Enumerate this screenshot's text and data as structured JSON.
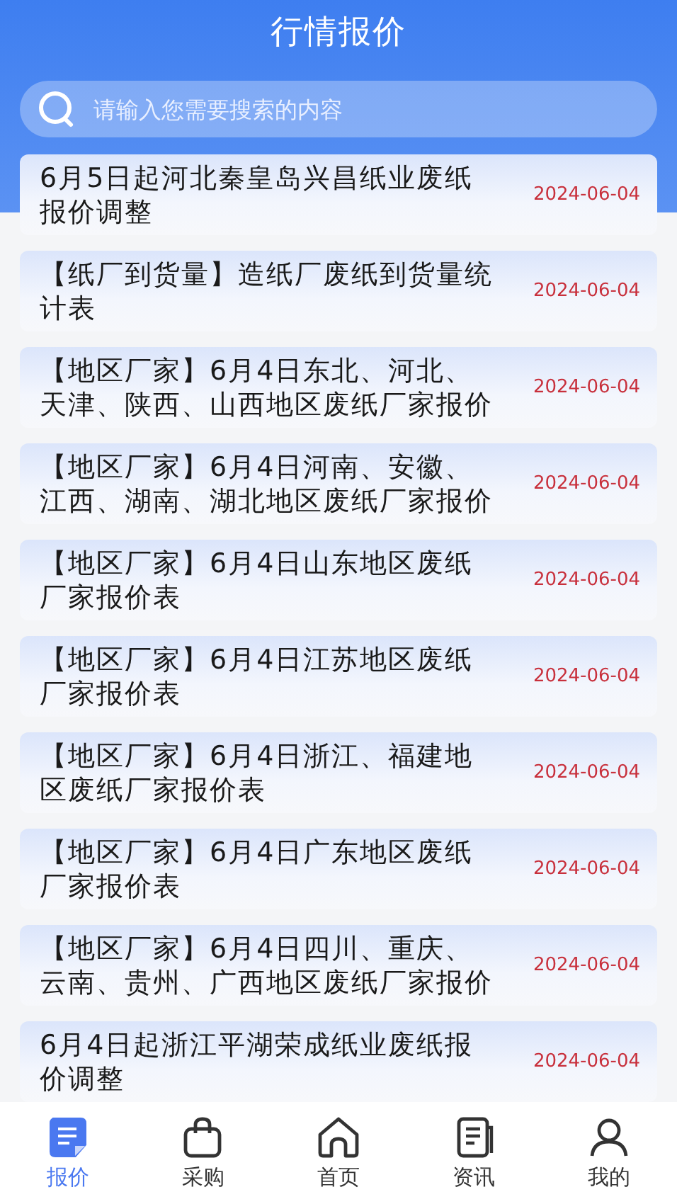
{
  "header": {
    "title": "行情报价"
  },
  "search": {
    "placeholder": "请输入您需要搜索的内容"
  },
  "items": [
    {
      "title": "6月5日起河北秦皇岛兴昌纸业废纸报价调整",
      "date": "2024-06-04"
    },
    {
      "title": "【纸厂到货量】造纸厂废纸到货量统计表",
      "date": "2024-06-04"
    },
    {
      "title": "【地区厂家】6月4日东北、河北、天津、陕西、山西地区废纸厂家报价",
      "date": "2024-06-04"
    },
    {
      "title": "【地区厂家】6月4日河南、安徽、江西、湖南、湖北地区废纸厂家报价",
      "date": "2024-06-04"
    },
    {
      "title": "【地区厂家】6月4日山东地区废纸厂家报价表",
      "date": "2024-06-04"
    },
    {
      "title": "【地区厂家】6月4日江苏地区废纸厂家报价表",
      "date": "2024-06-04"
    },
    {
      "title": "【地区厂家】6月4日浙江、福建地区废纸厂家报价表",
      "date": "2024-06-04"
    },
    {
      "title": "【地区厂家】6月4日广东地区废纸厂家报价表",
      "date": "2024-06-04"
    },
    {
      "title": "【地区厂家】6月4日四川、重庆、云南、贵州、广西地区废纸厂家报价",
      "date": "2024-06-04"
    },
    {
      "title": "6月4日起浙江平湖荣成纸业废纸报价调整",
      "date": "2024-06-04"
    }
  ],
  "nav": [
    {
      "kind": "quote",
      "label": "报价",
      "selected": true
    },
    {
      "kind": "bag",
      "label": "采购",
      "selected": false
    },
    {
      "kind": "home",
      "label": "首页",
      "selected": false
    },
    {
      "kind": "news",
      "label": "资讯",
      "selected": false
    },
    {
      "kind": "user",
      "label": "我的",
      "selected": false
    }
  ]
}
